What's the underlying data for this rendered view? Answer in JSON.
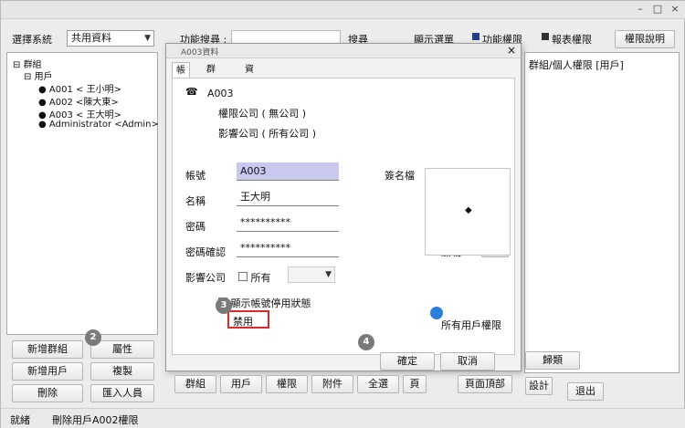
{
  "window": {
    "title": ""
  },
  "top": {
    "select_label": "選擇系統",
    "select_value": "共用資料",
    "func_label": "功能搜尋 :",
    "search_label": "搜尋",
    "display_label": "顯示選單",
    "perm1": "功能權限",
    "perm2": "報表權限",
    "perm_btn": "權限說明"
  },
  "tree": {
    "root": "群組",
    "users": "用戶",
    "items": [
      "A001 < 王小明>",
      "A002 <陳大東>",
      "A003 < 王大明>",
      "Administrator <Admin>"
    ]
  },
  "right_list": {
    "header": "群組/個人權限 [用戶]"
  },
  "dialog": {
    "title": "A003資料",
    "tabs": [
      "帳號",
      "群組別",
      "資料安全"
    ],
    "user_code": "A003",
    "company_line": "權限公司 ( 無公司 )",
    "company_line2": "影響公司 ( 所有公司 )",
    "fields": {
      "account_label": "帳號",
      "account_value": "A003",
      "name_label": "名稱",
      "name_value": "王大明",
      "password_label": "密碼",
      "password_value": "**********",
      "confirm_label": "密碼確認",
      "confirm_value": "**********",
      "company_label": "影響公司",
      "company_value": "所有"
    },
    "signature_label": "簽名檔",
    "load_label": "加載",
    "disable_checkbox_label": "顯示帳號停用狀態",
    "disable_button": "禁用",
    "all_users_label": "所有用戶權限",
    "ok_button": "確定",
    "cancel_button": "取消"
  },
  "left_buttons": {
    "add_group": "新增群組",
    "edit": "屬性",
    "add_user": "新增用戶",
    "copy": "複製",
    "delete": "刪除",
    "import": "匯入人員"
  },
  "bottom_bar": [
    "群組",
    "用戶",
    "權限",
    "附件",
    "全選",
    "頁",
    "頁面頂部",
    "確定"
  ],
  "right_buttons": {
    "design": "設計",
    "exit": "退出",
    "other": "歸類"
  },
  "status": {
    "left": "就緒",
    "right": "刪除用戶A002權限"
  },
  "badges": [
    "2",
    "3",
    "4"
  ]
}
